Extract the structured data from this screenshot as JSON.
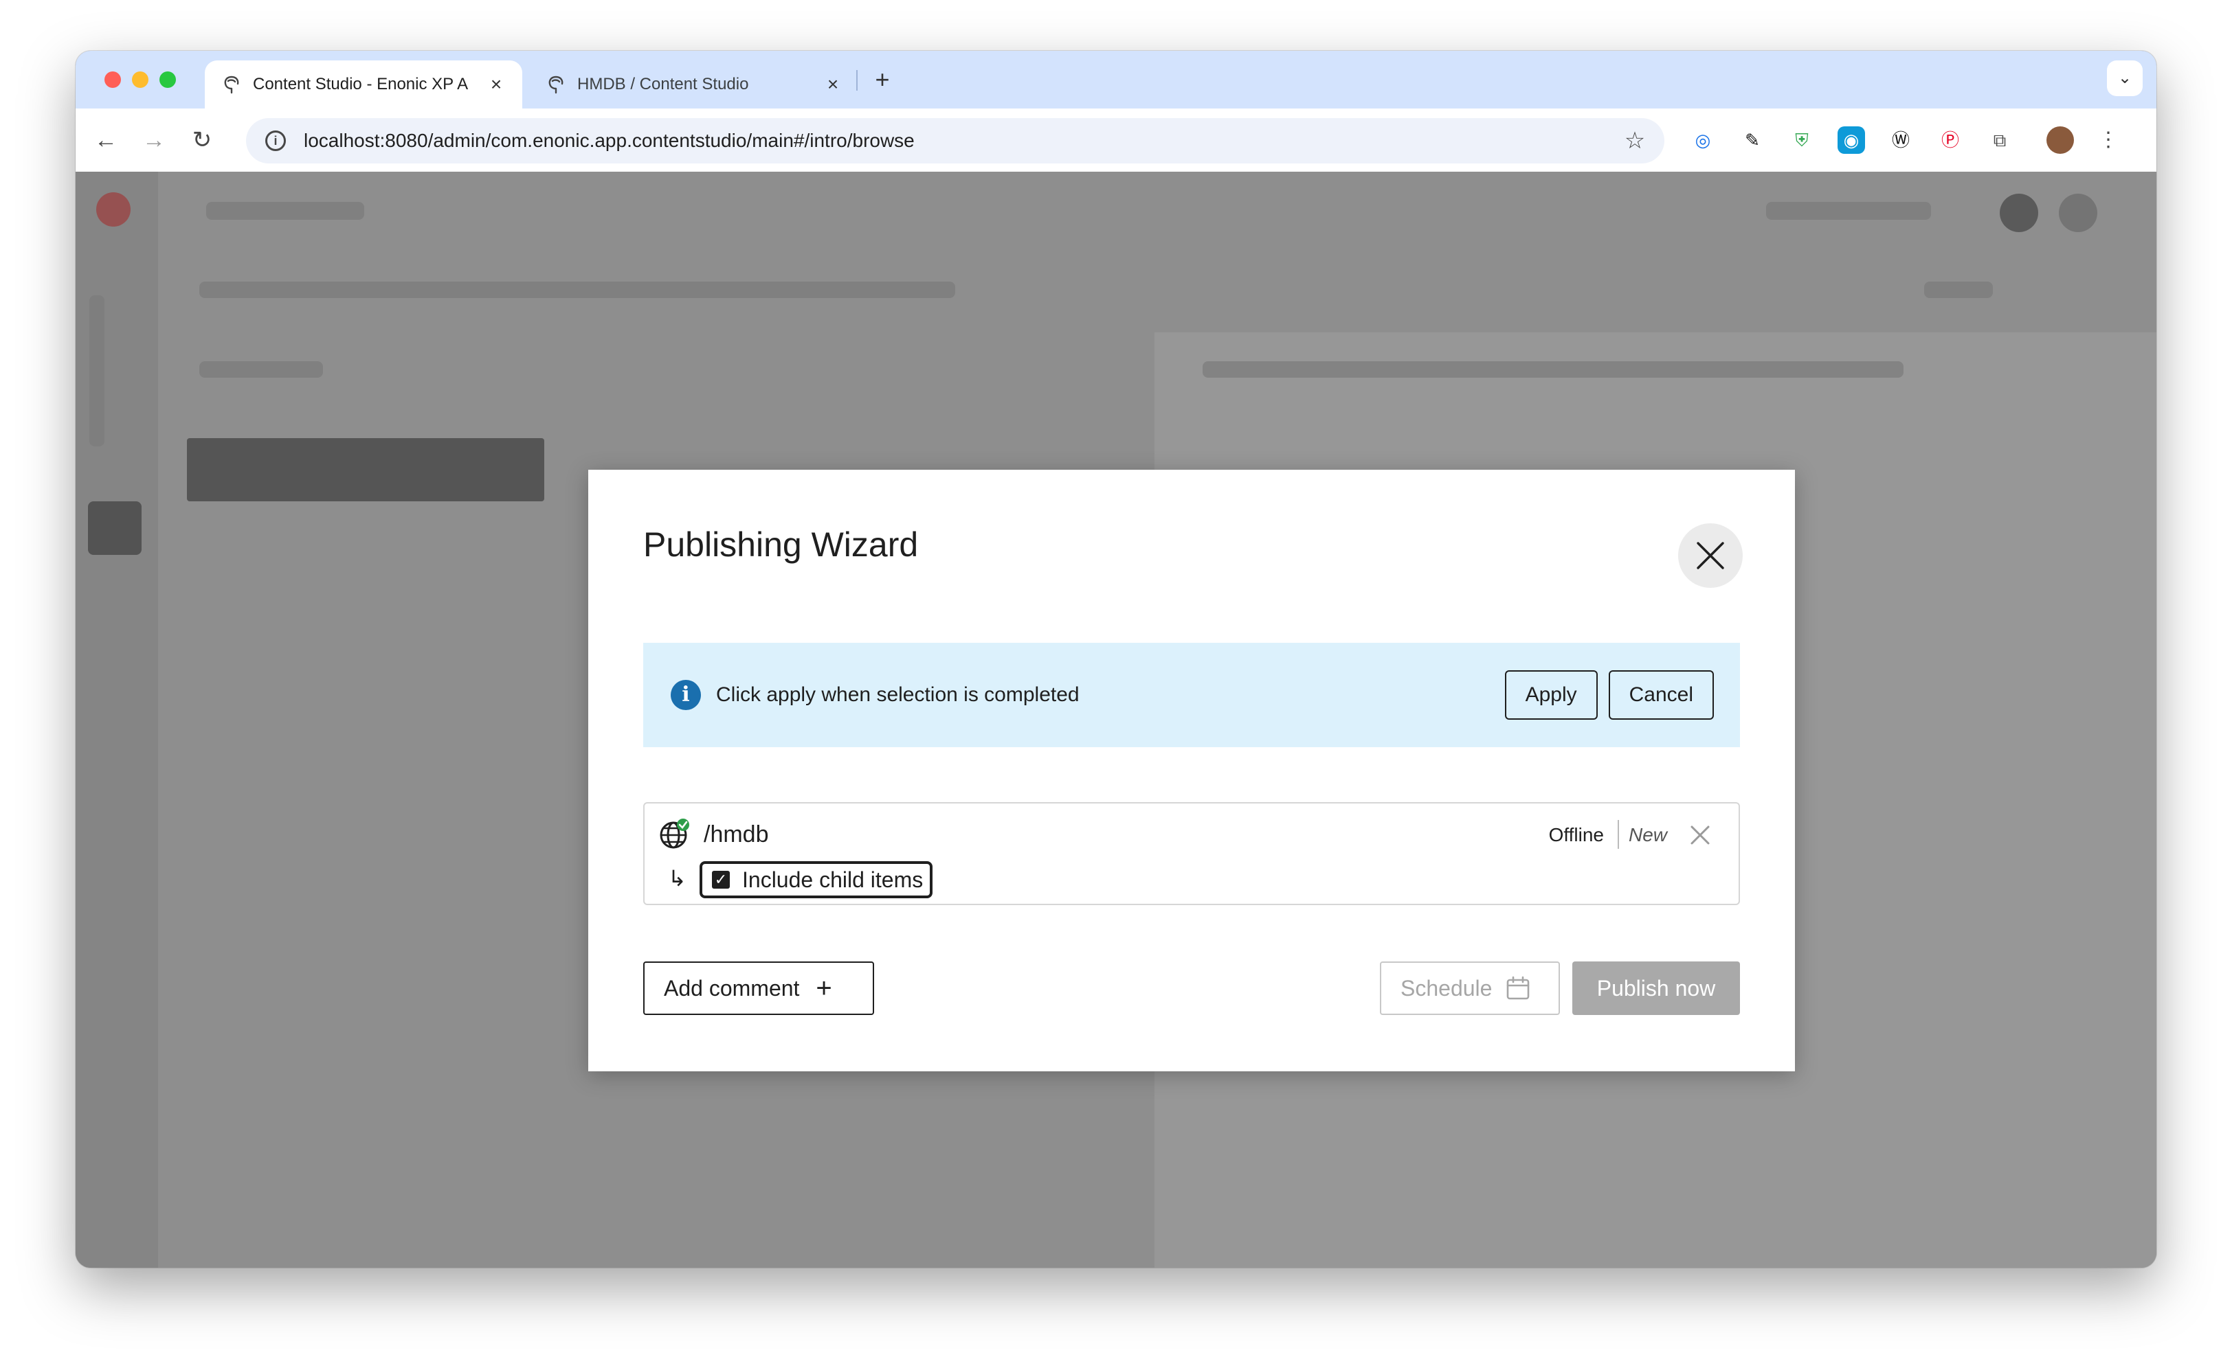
{
  "browser": {
    "tabs": [
      {
        "title": "Content Studio - Enonic XP A",
        "active": true
      },
      {
        "title": "HMDB / Content Studio",
        "active": false
      }
    ],
    "new_tab_label": "+",
    "url": "localhost:8080/admin/com.enonic.app.contentstudio/main#/intro/browse"
  },
  "dialog": {
    "title": "Publishing Wizard",
    "banner": {
      "text": "Click apply when selection is completed",
      "apply_label": "Apply",
      "cancel_label": "Cancel"
    },
    "item": {
      "path": "/hmdb",
      "status": "Offline",
      "state": "New",
      "include_children_label": "Include child items",
      "include_children_checked": true
    },
    "add_comment_label": "Add comment",
    "schedule_label": "Schedule",
    "publish_label": "Publish now"
  },
  "colors": {
    "banner_bg": "#dcf1fc",
    "info_icon": "#1a6fae",
    "publish_disabled": "#a9a9a9",
    "tabstrip": "#d3e3fd"
  }
}
